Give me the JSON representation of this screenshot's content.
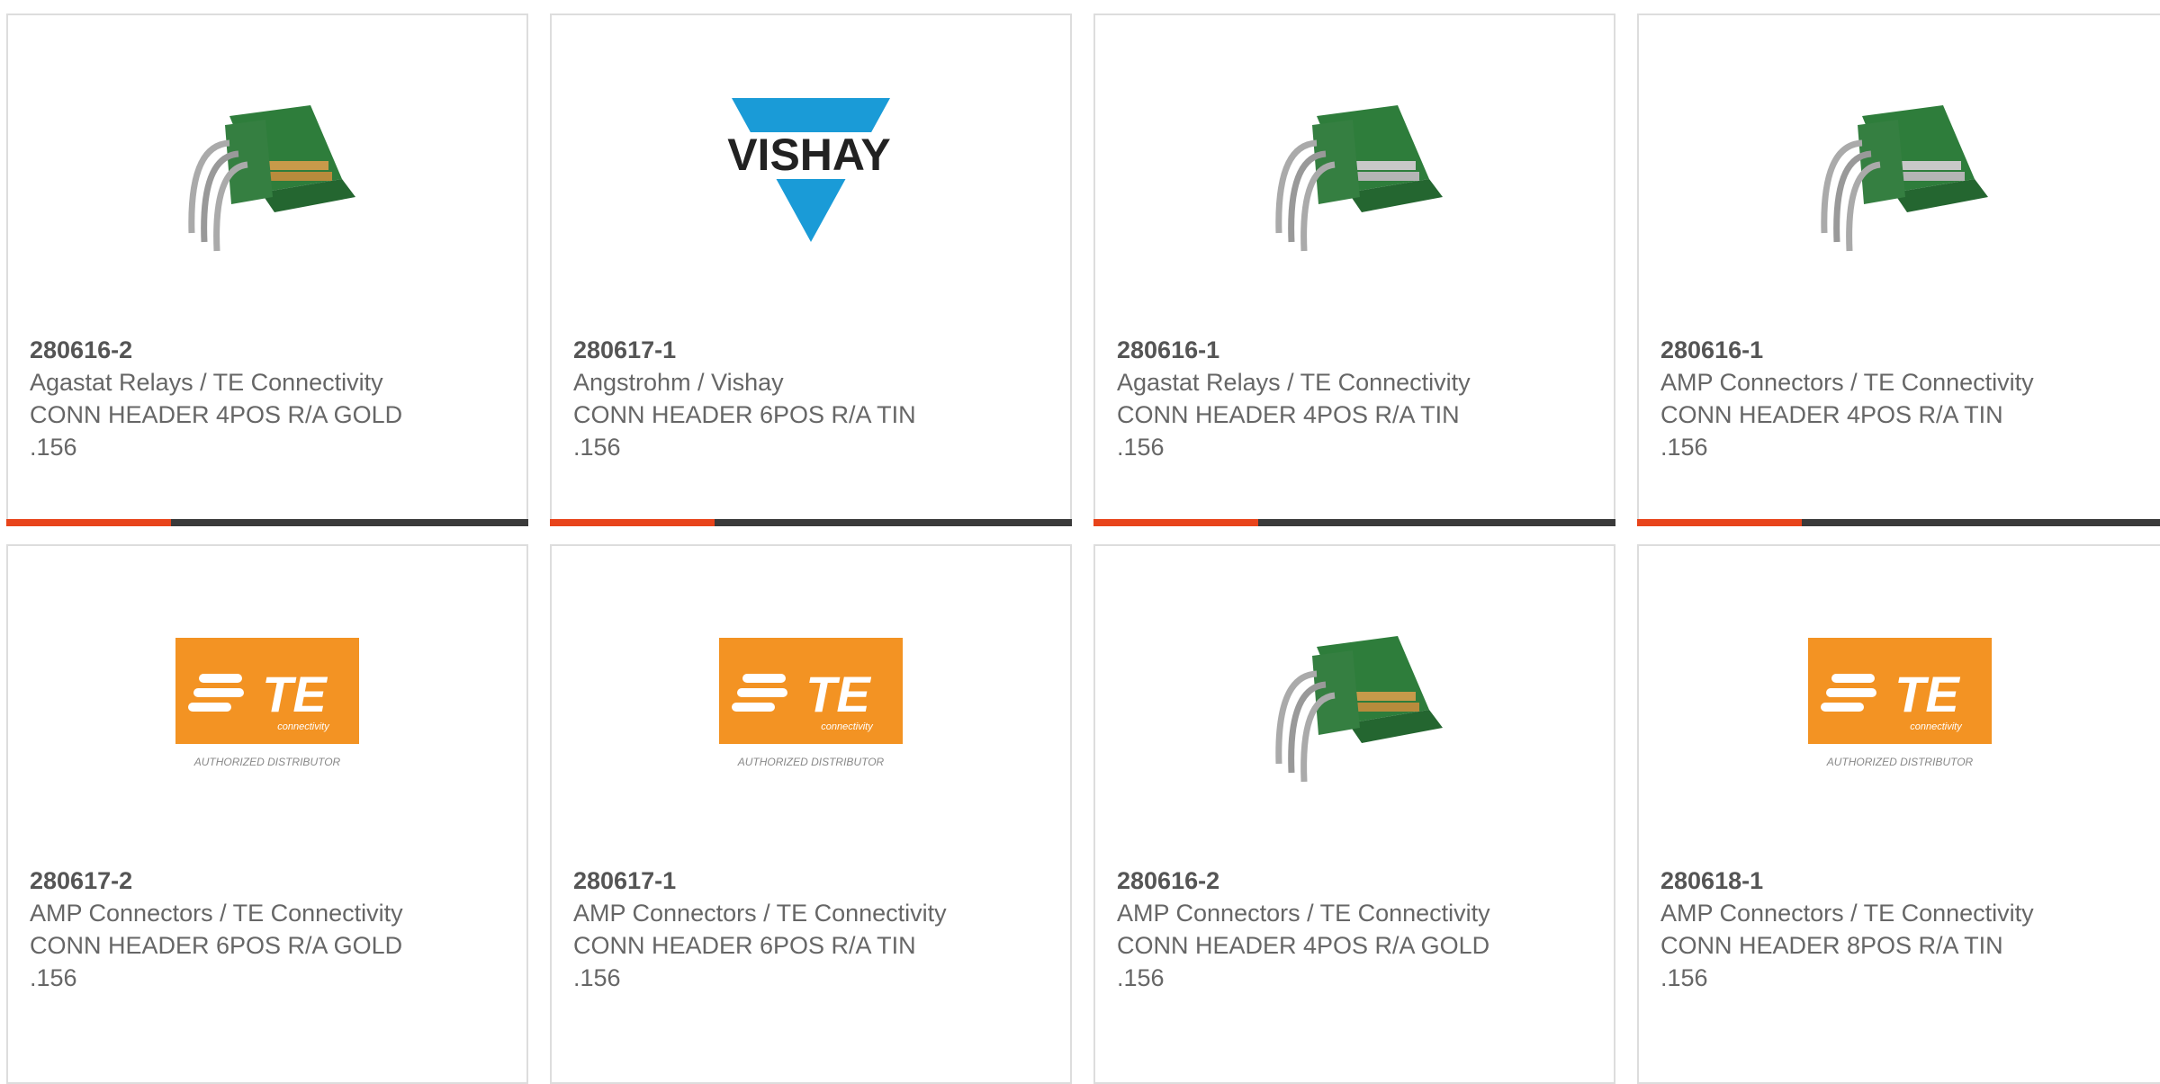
{
  "colors": {
    "accent": "#e8441b",
    "bar_dark": "#3a3a3a",
    "border": "#dddddd",
    "text": "#666666",
    "te_orange": "#f39323",
    "vishay_blue": "#1a9bd7",
    "connector_green": "#2e7d3b"
  },
  "cards": [
    {
      "part_number": "280616-2",
      "manufacturer": "Agastat Relays / TE Connectivity",
      "description": "CONN HEADER 4POS R/A GOLD .156",
      "image": "green-connector-gold-pins"
    },
    {
      "part_number": "280617-1",
      "manufacturer": "Angstrohm / Vishay",
      "description": "CONN HEADER 6POS R/A TIN .156",
      "image": "vishay-logo",
      "logo_text": "VISHAY"
    },
    {
      "part_number": "280616-1",
      "manufacturer": "Agastat Relays / TE Connectivity",
      "description": "CONN HEADER 4POS R/A TIN .156",
      "image": "green-connector-tin-pins"
    },
    {
      "part_number": "280616-1",
      "manufacturer": "AMP Connectors / TE Connectivity",
      "description": "CONN HEADER 4POS R/A TIN .156",
      "image": "green-connector-tin-pins"
    },
    {
      "part_number": "280617-2",
      "manufacturer": "AMP Connectors / TE Connectivity",
      "description": "CONN HEADER 6POS R/A GOLD .156",
      "image": "te-logo",
      "logo_text": "TE",
      "logo_sub": "connectivity",
      "logo_caption": "AUTHORIZED DISTRIBUTOR"
    },
    {
      "part_number": "280617-1",
      "manufacturer": "AMP Connectors / TE Connectivity",
      "description": "CONN HEADER 6POS R/A TIN .156",
      "image": "te-logo",
      "logo_text": "TE",
      "logo_sub": "connectivity",
      "logo_caption": "AUTHORIZED DISTRIBUTOR"
    },
    {
      "part_number": "280616-2",
      "manufacturer": "AMP Connectors / TE Connectivity",
      "description": "CONN HEADER 4POS R/A GOLD .156",
      "image": "green-connector-gold-pins"
    },
    {
      "part_number": "280618-1",
      "manufacturer": "AMP Connectors / TE Connectivity",
      "description": "CONN HEADER 8POS R/A TIN .156",
      "image": "te-logo",
      "logo_text": "TE",
      "logo_sub": "connectivity",
      "logo_caption": "AUTHORIZED DISTRIBUTOR"
    }
  ]
}
